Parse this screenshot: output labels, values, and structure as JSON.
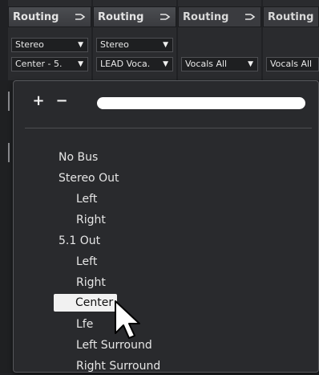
{
  "strips": [
    {
      "header": "Routing",
      "input": "Stereo",
      "output": "Center - 5."
    },
    {
      "header": "Routing",
      "input": "Stereo",
      "output": "LEAD Voca."
    },
    {
      "header": "Routing",
      "input": "",
      "output": "Vocals All"
    },
    {
      "header": "Routing",
      "input": "",
      "output": "Vocals All"
    }
  ],
  "icons": {
    "routing": "routing-icon",
    "dropdown": "triangle-down-icon",
    "cursor": "mouse-pointer-icon"
  },
  "popup": {
    "add_label": "+",
    "remove_label": "−",
    "search_value": "",
    "items": [
      {
        "label": "No Bus",
        "level": 0
      },
      {
        "label": "Stereo Out",
        "level": 0
      },
      {
        "label": "Left",
        "level": 1
      },
      {
        "label": "Right",
        "level": 1
      },
      {
        "label": "5.1 Out",
        "level": 0
      },
      {
        "label": "Left",
        "level": 1
      },
      {
        "label": "Right",
        "level": 1
      },
      {
        "label": "Center",
        "level": 1,
        "selected": true
      },
      {
        "label": "Lfe",
        "level": 1
      },
      {
        "label": "Left Surround",
        "level": 1
      },
      {
        "label": "Right Surround",
        "level": 1
      }
    ]
  },
  "dropdown_arrow": "▼"
}
